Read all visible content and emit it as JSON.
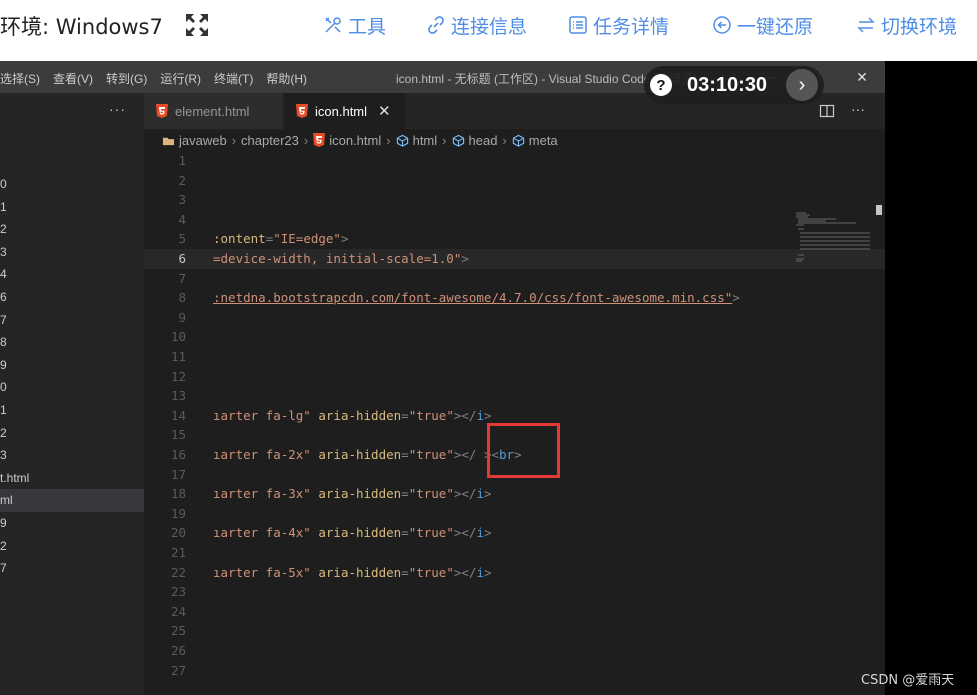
{
  "topbar": {
    "env_label": "环境: Windows7",
    "buttons": [
      {
        "label": "工具",
        "icon": "tools-icon"
      },
      {
        "label": "连接信息",
        "icon": "link-icon"
      },
      {
        "label": "任务详情",
        "icon": "task-list-icon"
      },
      {
        "label": "一键还原",
        "icon": "restore-icon"
      },
      {
        "label": "切换环境",
        "icon": "switch-icon"
      }
    ],
    "accent_color": "#4f8ee6"
  },
  "timer": {
    "value": "03:10:30",
    "help": "?"
  },
  "vscode": {
    "menu": [
      "选择(S)",
      "查看(V)",
      "转到(G)",
      "运行(R)",
      "终端(T)",
      "帮助(H)"
    ],
    "window_title": "icon.html - 无标题 (工作区) - Visual Studio Code [管理员]",
    "tabs": [
      {
        "label": "element.html",
        "active": false
      },
      {
        "label": "icon.html",
        "active": true
      }
    ],
    "breadcrumb": [
      "javaweb",
      "chapter23",
      "icon.html",
      "html",
      "head",
      "meta"
    ],
    "sidebar_files": [
      "0",
      "1",
      "2",
      "3",
      "4",
      "6",
      "7",
      "8",
      "9",
      "0",
      "1",
      "2",
      "3",
      "t.html",
      "ml",
      "9",
      "2",
      "7"
    ],
    "active_file_index": 14,
    "current_line": 6,
    "lines": [
      {
        "n": "1",
        "html": ""
      },
      {
        "n": "2",
        "html": ""
      },
      {
        "n": "3",
        "html": ""
      },
      {
        "n": "4",
        "html": ""
      },
      {
        "n": "5",
        "html": "<span class='attr'>:ontent</span><span class='punc'>=</span><span class='str'>\"IE=edge\"</span><span class='punc'>&gt;</span>"
      },
      {
        "n": "6",
        "html": "<span class='str'>=device-width, initial-scale=1.0\"</span><span class='punc'>&gt;</span>"
      },
      {
        "n": "7",
        "html": ""
      },
      {
        "n": "8",
        "html": "<span class='url'>:netdna.bootstrapcdn.com/font-awesome/4.7.0/css/font-awesome.min.css\"</span><span class='punc'>&gt;</span>"
      },
      {
        "n": "9",
        "html": ""
      },
      {
        "n": "10",
        "html": ""
      },
      {
        "n": "11",
        "html": ""
      },
      {
        "n": "12",
        "html": ""
      },
      {
        "n": "13",
        "html": ""
      },
      {
        "n": "14",
        "html": "<span class='str'>ıarter fa-lg\"</span> <span class='attr'>aria-hidden</span><span class='punc'>=</span><span class='str'>\"true\"</span><span class='punc'>&gt;&lt;/</span><span class='tag'>i</span><span class='punc'>&gt;</span>"
      },
      {
        "n": "15",
        "html": ""
      },
      {
        "n": "16",
        "html": "<span class='str'>ıarter fa-2x\"</span> <span class='attr'>aria-hidden</span><span class='punc'>=</span><span class='str'>\"true\"</span><span class='punc'>&gt;&lt;/ &gt;&lt;</span><span class='tag'>br</span><span class='punc'>&gt;</span>"
      },
      {
        "n": "17",
        "html": ""
      },
      {
        "n": "18",
        "html": "<span class='str'>ıarter fa-3x\"</span> <span class='attr'>aria-hidden</span><span class='punc'>=</span><span class='str'>\"true\"</span><span class='punc'>&gt;&lt;/</span><span class='tag'>i</span><span class='punc'>&gt;</span>"
      },
      {
        "n": "19",
        "html": ""
      },
      {
        "n": "20",
        "html": "<span class='str'>ıarter fa-4x\"</span> <span class='attr'>aria-hidden</span><span class='punc'>=</span><span class='str'>\"true\"</span><span class='punc'>&gt;&lt;/</span><span class='tag'>i</span><span class='punc'>&gt;</span>"
      },
      {
        "n": "21",
        "html": ""
      },
      {
        "n": "22",
        "html": "<span class='str'>ıarter fa-5x\"</span> <span class='attr'>aria-hidden</span><span class='punc'>=</span><span class='str'>\"true\"</span><span class='punc'>&gt;&lt;/</span><span class='tag'>i</span><span class='punc'>&gt;</span>"
      },
      {
        "n": "23",
        "html": ""
      },
      {
        "n": "24",
        "html": ""
      },
      {
        "n": "25",
        "html": ""
      },
      {
        "n": "26",
        "html": ""
      },
      {
        "n": "27",
        "html": ""
      }
    ]
  },
  "watermark": "CSDN @爱雨天"
}
